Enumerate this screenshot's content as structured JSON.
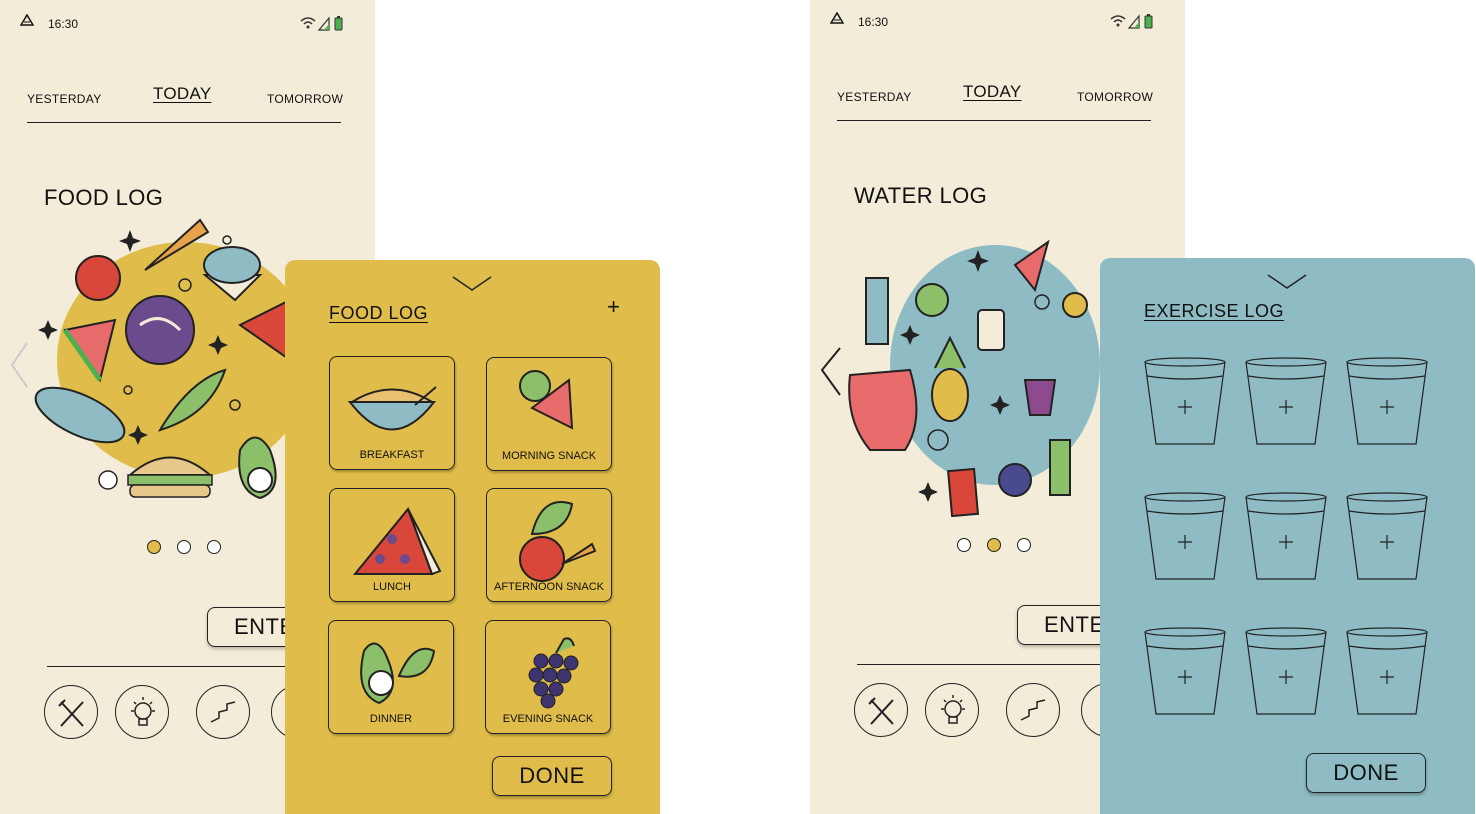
{
  "status_time": "16:30",
  "day_nav": {
    "yesterday": "YESTERDAY",
    "today": "TODAY",
    "tomorrow": "TOMORROW"
  },
  "screen1": {
    "title": "FOOD LOG",
    "enter_label": "ENTE",
    "active_dot": 0
  },
  "food_sheet": {
    "title": "FOOD LOG",
    "add_icon": "plus-icon",
    "meals": [
      "BREAKFAST",
      "MORNING SNACK",
      "LUNCH",
      "AFTERNOON SNACK",
      "DINNER",
      "EVENING SNACK"
    ],
    "done_label": "DONE",
    "color": "#e0bd4a"
  },
  "screen2": {
    "title": "WATER LOG",
    "enter_label": "ENTE",
    "active_dot": 1
  },
  "exercise_sheet": {
    "title": "EXERCISE LOG",
    "glass_count": 9,
    "done_label": "DONE",
    "color": "#8fbcc4"
  },
  "colors": {
    "background": "#f3ecd9",
    "accent_yellow": "#e0bd4a",
    "accent_blue": "#8fbcc4"
  }
}
